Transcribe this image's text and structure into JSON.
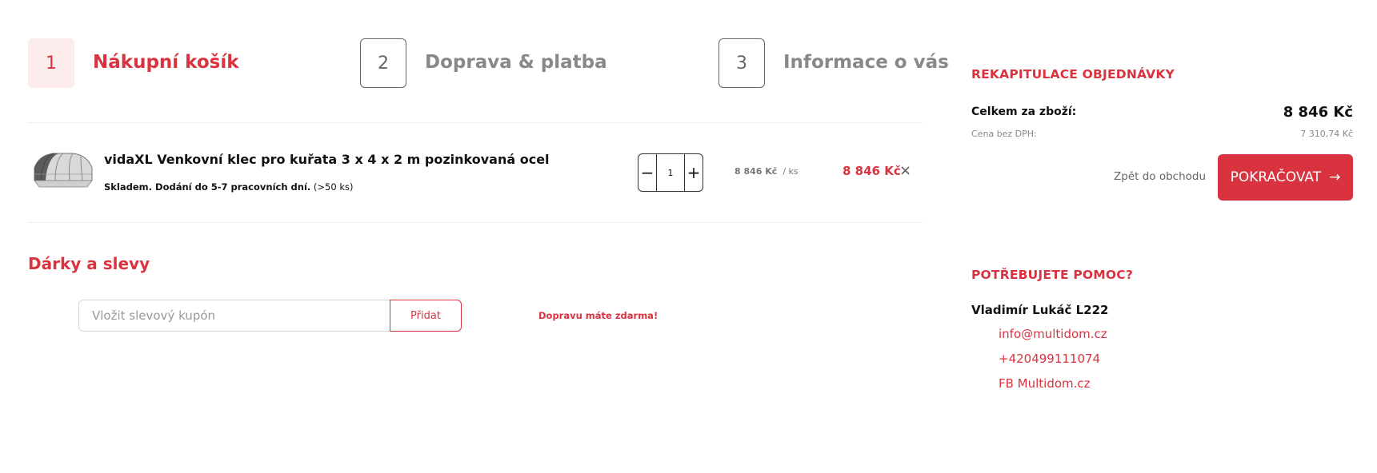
{
  "colors": {
    "accent": "#d93340",
    "accent_light": "#fcecec",
    "muted": "#888888"
  },
  "steps": [
    {
      "number": "1",
      "label": "Nákupní košík",
      "state": "active"
    },
    {
      "number": "2",
      "label": "Doprava & platba",
      "state": "inactive"
    },
    {
      "number": "3",
      "label": "Informace o vás",
      "state": "inactive"
    }
  ],
  "cart": {
    "items": [
      {
        "name": "vidaXL Venkovní klec pro kuřata 3 x 4 x 2 m pozinkovaná ocel",
        "stock_bold": "Skladem. Dodání do 5-7 pracovních dní.",
        "stock_extra": "(>50 ks)",
        "quantity": "1",
        "qty_minus": "−",
        "qty_plus": "+",
        "unit_price": "8 846 Kč",
        "unit_suffix": "/ ks",
        "total": "8 846 Kč",
        "remove_icon": "×"
      }
    ]
  },
  "gifts": {
    "title": "Dárky a slevy",
    "coupon_placeholder": "Vložit slevový kupón",
    "coupon_button": "Přidat",
    "free_shipping": "Dopravu máte zdarma!"
  },
  "summary": {
    "heading": "REKAPITULACE OBJEDNÁVKY",
    "total_label": "Celkem za zboží:",
    "total_value": "8 846 Kč",
    "net_label": "Cena bez DPH:",
    "net_value": "7 310,74 Kč",
    "back_link": "Zpět do obchodu",
    "continue_button": "POKRAČOVAT",
    "continue_icon": "→"
  },
  "help": {
    "heading": "POTŘEBUJETE POMOC?",
    "contact_name": "Vladimír Lukáč L222",
    "email": "info@multidom.cz",
    "phone": "+420499111074",
    "facebook": "FB Multidom.cz"
  }
}
